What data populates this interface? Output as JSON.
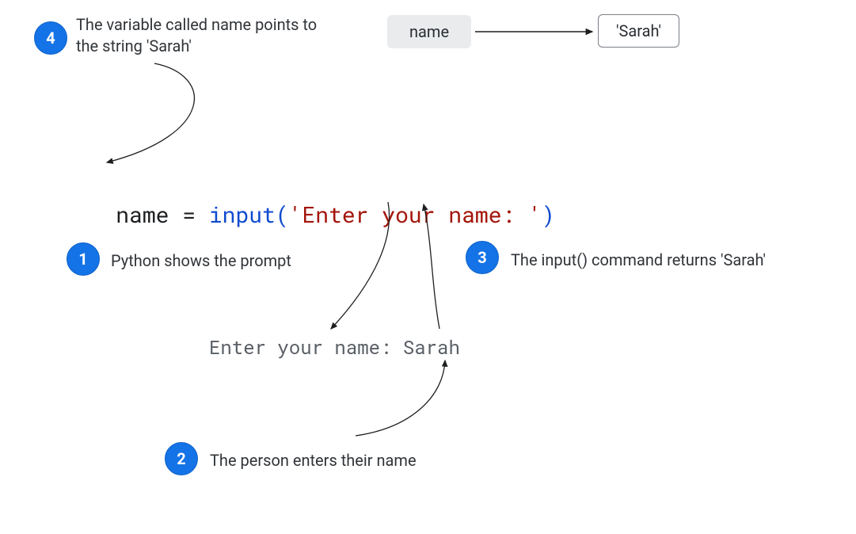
{
  "steps": {
    "s1": {
      "num": "1",
      "text": "Python shows the prompt"
    },
    "s2": {
      "num": "2",
      "text": "The person enters their name"
    },
    "s3": {
      "num": "3",
      "text": "The input() command returns 'Sarah'"
    },
    "s4": {
      "num": "4",
      "text": "The variable called name points to the string 'Sarah'"
    }
  },
  "memory": {
    "var_label": "name",
    "val_label": "'Sarah'"
  },
  "code": {
    "seg1": "name = ",
    "func": "input",
    "lp": "(",
    "str": "'Enter your name: '",
    "rp": ")"
  },
  "terminal": {
    "line": "Enter your name: Sarah"
  }
}
